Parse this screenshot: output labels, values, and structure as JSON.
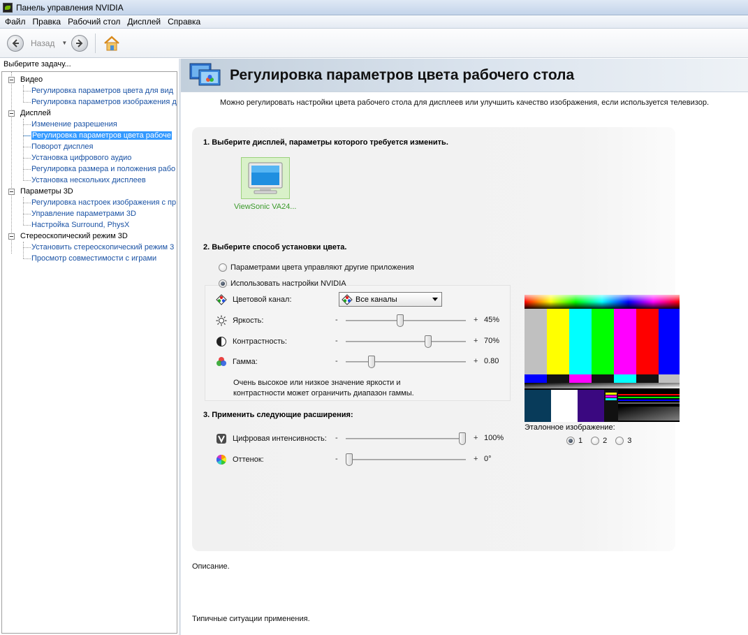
{
  "window": {
    "title": "Панель управления NVIDIA"
  },
  "menu": [
    "Файл",
    "Правка",
    "Рабочий стол",
    "Дисплей",
    "Справка"
  ],
  "toolbar": {
    "back_label": "Назад"
  },
  "sidebar": {
    "header": "Выберите задачу...",
    "categories": [
      {
        "label": "Видео",
        "items": [
          "Регулировка параметров цвета для вид",
          "Регулировка параметров изображения д"
        ]
      },
      {
        "label": "Дисплей",
        "items": [
          "Изменение разрешения",
          "Регулировка параметров цвета рабоче",
          "Поворот дисплея",
          "Установка цифрового аудио",
          "Регулировка размера и положения рабо",
          "Установка нескольких дисплеев"
        ]
      },
      {
        "label": "Параметры 3D",
        "items": [
          "Регулировка настроек изображения с пр",
          "Управление параметрами 3D",
          "Настройка Surround, PhysX"
        ]
      },
      {
        "label": "Стереоскопический режим 3D",
        "items": [
          "Установить стереоскопический режим 3",
          "Просмотр совместимости с играми"
        ]
      }
    ],
    "selected": "Регулировка параметров цвета рабоче"
  },
  "page": {
    "title": "Регулировка параметров цвета рабочего стола",
    "subtitle": "Можно регулировать настройки цвета рабочего стола для дисплеев или улучшить качество изображения, если используется телевизор.",
    "step1": "1. Выберите дисплей, параметры которого требуется изменить.",
    "display_name": "ViewSonic VA24...",
    "step2": "2. Выберите способ установки цвета.",
    "radio_other": "Параметрами цвета управляют другие приложения",
    "radio_nvidia": "Использовать настройки NVIDIA",
    "channel_label": "Цветовой канал:",
    "channel_value": "Все каналы",
    "brightness_label": "Яркость:",
    "brightness_value": "45%",
    "brightness_level": 0.45,
    "contrast_label": "Контрастность:",
    "contrast_value": "70%",
    "contrast_level": 0.7,
    "gamma_label": "Гамма:",
    "gamma_value": "0.80",
    "gamma_level": 0.2,
    "hint_line1": "Очень высокое или низкое значение яркости и",
    "hint_line2": "контрастности может ограничить диапазон гаммы.",
    "step3": "3. Применить следующие расширения:",
    "vibrance_label": "Цифровая интенсивность:",
    "vibrance_value": "100%",
    "vibrance_level": 1.0,
    "hue_label": "Оттенок:",
    "hue_value": "0°",
    "hue_level": 0.0,
    "minus": "-",
    "plus": "+",
    "reference_label": "Эталонное изображение:",
    "reference_options": [
      "1",
      "2",
      "3"
    ],
    "reference_selected": "1",
    "description_label": "Описание.",
    "usage_label": "Типичные ситуации применения."
  },
  "colors": {
    "accent_green": "#76b900",
    "selection_blue": "#3399ff",
    "link_blue": "#1a52a4"
  }
}
